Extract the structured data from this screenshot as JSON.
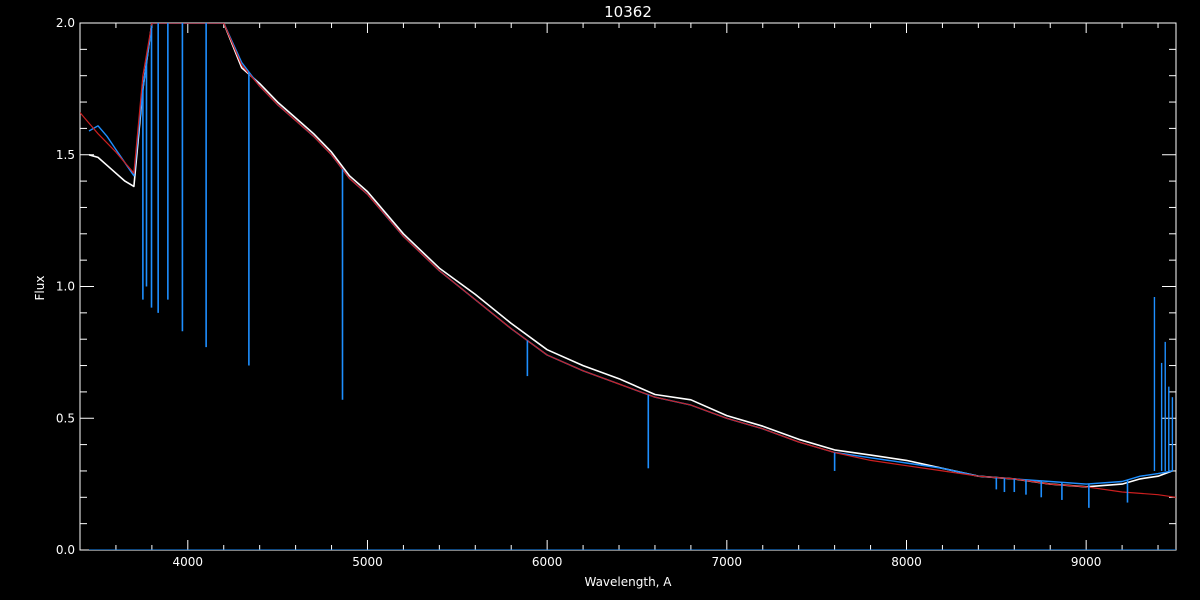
{
  "chart_data": {
    "type": "line",
    "title": "10362",
    "xlabel": "Wavelength, A",
    "ylabel": "Flux",
    "xlim": [
      3400,
      9500
    ],
    "ylim": [
      0.0,
      2.0
    ],
    "xticks": [
      4000,
      5000,
      6000,
      7000,
      8000,
      9000
    ],
    "xtick_labels": [
      "4000",
      "5000",
      "6000",
      "7000",
      "8000",
      "9000"
    ],
    "yticks": [
      0.0,
      0.5,
      1.0,
      1.5,
      2.0
    ],
    "ytick_labels": [
      "0.0",
      "0.5",
      "1.0",
      "1.5",
      "2.0"
    ],
    "grid": false,
    "background": "#000000",
    "series": [
      {
        "color": "#ffffff",
        "x": [
          3450,
          3500,
          3550,
          3600,
          3650,
          3700,
          3750,
          3800,
          3900,
          4000,
          4100,
          4200,
          4300,
          4400,
          4500,
          4600,
          4700,
          4800,
          4900,
          5000,
          5200,
          5400,
          5600,
          5800,
          6000,
          6200,
          6400,
          6600,
          6800,
          7000,
          7200,
          7400,
          7600,
          7800,
          8000,
          8200,
          8400,
          8600,
          8800,
          9000,
          9200,
          9300,
          9400,
          9480
        ],
        "y": [
          1.5,
          1.49,
          1.46,
          1.43,
          1.4,
          1.38,
          1.75,
          2.0,
          2.0,
          2.0,
          2.0,
          2.0,
          1.83,
          1.77,
          1.7,
          1.64,
          1.58,
          1.51,
          1.42,
          1.36,
          1.2,
          1.07,
          0.97,
          0.86,
          0.76,
          0.7,
          0.65,
          0.59,
          0.57,
          0.51,
          0.47,
          0.42,
          0.38,
          0.36,
          0.34,
          0.31,
          0.28,
          0.27,
          0.25,
          0.24,
          0.25,
          0.27,
          0.28,
          0.3
        ]
      },
      {
        "color": "#1e8fff",
        "x": [
          3450,
          3500,
          3550,
          3600,
          3650,
          3700,
          3750,
          3800,
          3900,
          4000,
          4100,
          4200,
          4300,
          4400,
          4500,
          4600,
          4700,
          4800,
          4900,
          5000,
          5200,
          5400,
          5600,
          5800,
          6000,
          6200,
          6400,
          6600,
          6800,
          7000,
          7200,
          7400,
          7600,
          7800,
          8000,
          8200,
          8400,
          8600,
          8800,
          9000,
          9200,
          9300,
          9400,
          9480
        ],
        "y": [
          1.59,
          1.61,
          1.57,
          1.52,
          1.47,
          1.42,
          1.75,
          2.0,
          2.0,
          2.0,
          2.0,
          2.0,
          1.85,
          1.76,
          1.69,
          1.63,
          1.57,
          1.5,
          1.41,
          1.35,
          1.19,
          1.06,
          0.95,
          0.84,
          0.74,
          0.68,
          0.63,
          0.58,
          0.55,
          0.5,
          0.46,
          0.41,
          0.37,
          0.35,
          0.33,
          0.31,
          0.28,
          0.27,
          0.26,
          0.25,
          0.26,
          0.28,
          0.29,
          0.3
        ]
      },
      {
        "color": "#cc1f1f",
        "x": [
          3400,
          3500,
          3600,
          3700,
          3750,
          3800,
          3900,
          4000,
          4100,
          4200,
          4300,
          4400,
          4500,
          4600,
          4700,
          4800,
          4900,
          5000,
          5200,
          5400,
          5600,
          5800,
          6000,
          6200,
          6400,
          6600,
          6800,
          7000,
          7200,
          7400,
          7600,
          7800,
          8000,
          8200,
          8400,
          8600,
          8800,
          9000,
          9200,
          9400,
          9500
        ],
        "y": [
          1.66,
          1.58,
          1.51,
          1.43,
          1.8,
          2.0,
          2.0,
          2.0,
          2.0,
          2.0,
          1.84,
          1.76,
          1.69,
          1.63,
          1.57,
          1.5,
          1.41,
          1.35,
          1.19,
          1.06,
          0.95,
          0.84,
          0.74,
          0.68,
          0.63,
          0.58,
          0.55,
          0.5,
          0.46,
          0.41,
          0.37,
          0.34,
          0.32,
          0.3,
          0.28,
          0.27,
          0.25,
          0.24,
          0.22,
          0.21,
          0.2
        ]
      },
      {
        "color": "#1e8fff",
        "x": [
          3450,
          5000,
          7000,
          9000,
          9500
        ],
        "y": [
          0.0,
          0.0,
          0.0,
          0.0,
          0.0
        ]
      }
    ],
    "absorption_lines": [
      {
        "x": 3750,
        "depth_to": 0.95
      },
      {
        "x": 3770,
        "depth_to": 1.0
      },
      {
        "x": 3798,
        "depth_to": 0.92
      },
      {
        "x": 3835,
        "depth_to": 0.9
      },
      {
        "x": 3889,
        "depth_to": 0.95
      },
      {
        "x": 3970,
        "depth_to": 0.83
      },
      {
        "x": 4102,
        "depth_to": 0.77
      },
      {
        "x": 4340,
        "depth_to": 0.7
      },
      {
        "x": 4861,
        "depth_to": 0.57
      },
      {
        "x": 6563,
        "depth_to": 0.31
      },
      {
        "x": 5890,
        "depth_to": 0.66
      },
      {
        "x": 7600,
        "depth_to": 0.3
      },
      {
        "x": 8500,
        "depth_to": 0.23
      },
      {
        "x": 8545,
        "depth_to": 0.22
      },
      {
        "x": 8600,
        "depth_to": 0.22
      },
      {
        "x": 8665,
        "depth_to": 0.21
      },
      {
        "x": 8750,
        "depth_to": 0.2
      },
      {
        "x": 8865,
        "depth_to": 0.19
      },
      {
        "x": 9015,
        "depth_to": 0.16
      },
      {
        "x": 9230,
        "depth_to": 0.18
      }
    ],
    "emission_spikes": [
      {
        "x": 9380,
        "peak": 0.96
      },
      {
        "x": 9420,
        "peak": 0.71
      },
      {
        "x": 9440,
        "peak": 0.79
      },
      {
        "x": 9460,
        "peak": 0.62
      },
      {
        "x": 9480,
        "peak": 0.58
      }
    ]
  }
}
